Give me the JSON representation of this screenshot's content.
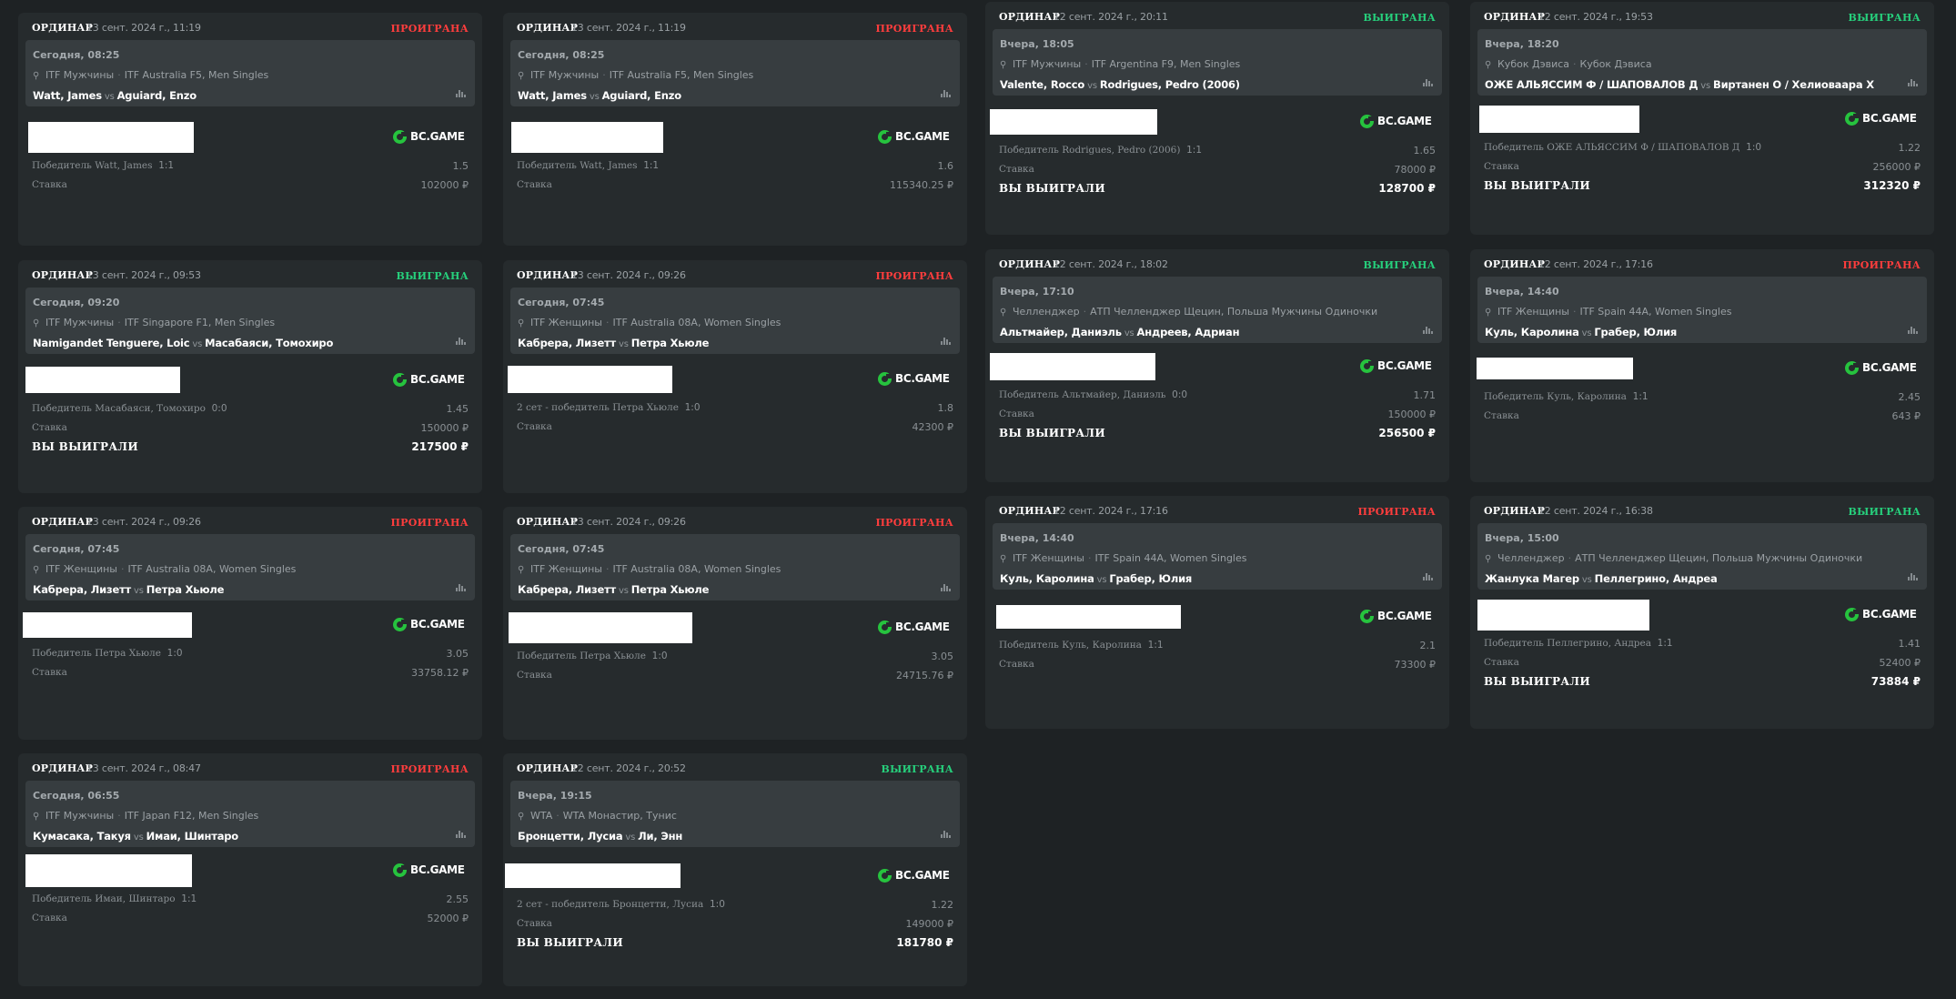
{
  "labels": {
    "type": "ОРДИНАР",
    "stake": "Ставка",
    "win": "ВЫ ВЫИГРАЛИ",
    "vs": "vs",
    "brand": "BC.GAME"
  },
  "colors": {
    "lost": "#ff3d3d",
    "won": "#26d07c",
    "brand": "#26c33e"
  },
  "icons": {
    "sport": "tennis-racket-icon",
    "stats": "stats-bars-icon",
    "brand": "bcgame-logo-icon"
  },
  "cards": [
    {
      "date": "13 сент. 2024 г., 11:19",
      "status": "ПРОИГРАНА",
      "result": "lost",
      "event_time": "Сегодня, 08:25",
      "category": "ITF Мужчины",
      "tournament": "ITF Australia F5, Men Singles",
      "team1": "Watt, James",
      "team2": "Aguiard, Enzo",
      "selection": "Победитель Watt, James",
      "score": "1:1",
      "odds": "1.5",
      "stake": "102000 ₽",
      "win_amount": ""
    },
    {
      "date": "13 сент. 2024 г., 11:19",
      "status": "ПРОИГРАНА",
      "result": "lost",
      "event_time": "Сегодня, 08:25",
      "category": "ITF Мужчины",
      "tournament": "ITF Australia F5, Men Singles",
      "team1": "Watt, James",
      "team2": "Aguiard, Enzo",
      "selection": "Победитель Watt, James",
      "score": "1:1",
      "odds": "1.6",
      "stake": "115340.25 ₽",
      "win_amount": ""
    },
    {
      "date": "12 сент. 2024 г., 20:11",
      "status": "ВЫИГРАНА",
      "result": "won",
      "event_time": "Вчера, 18:05",
      "category": "ITF Мужчины",
      "tournament": "ITF Argentina F9, Men Singles",
      "team1": "Valente, Rocco",
      "team2": "Rodrigues, Pedro (2006)",
      "selection": "Победитель Rodrigues, Pedro (2006)",
      "score": "1:1",
      "odds": "1.65",
      "stake": "78000 ₽",
      "win_amount": "128700 ₽"
    },
    {
      "date": "12 сент. 2024 г., 19:53",
      "status": "ВЫИГРАНА",
      "result": "won",
      "event_time": "Вчера, 18:20",
      "category": "Кубок Дэвиса",
      "tournament": "Кубок Дэвиса",
      "team1": "ОЖЕ АЛЬЯССИМ Ф / ШАПОВАЛОВ Д",
      "team2": "Виртанен О / Хелиоваара Х",
      "selection": "Победитель ОЖЕ АЛЬЯССИМ Ф / ШАПОВАЛОВ Д",
      "score": "1:0",
      "odds": "1.22",
      "stake": "256000 ₽",
      "win_amount": "312320 ₽"
    },
    {
      "date": "13 сент. 2024 г., 09:53",
      "status": "ВЫИГРАНА",
      "result": "won",
      "event_time": "Сегодня, 09:20",
      "category": "ITF Мужчины",
      "tournament": "ITF Singapore F1, Men Singles",
      "team1": "Namigandet Tenguere, Loic",
      "team2": "Масабаяси, Томохиро",
      "selection": "Победитель Масабаяси, Томохиро",
      "score": "0:0",
      "odds": "1.45",
      "stake": "150000 ₽",
      "win_amount": "217500 ₽"
    },
    {
      "date": "13 сент. 2024 г., 09:26",
      "status": "ПРОИГРАНА",
      "result": "lost",
      "event_time": "Сегодня, 07:45",
      "category": "ITF Женщины",
      "tournament": "ITF Australia 08A, Women Singles",
      "team1": "Кабрера, Лизетт",
      "team2": "Петра Хьюле",
      "selection": "2 сет - победитель Петра Хьюле",
      "score": "1:0",
      "odds": "1.8",
      "stake": "42300 ₽",
      "win_amount": ""
    },
    {
      "date": "12 сент. 2024 г., 18:02",
      "status": "ВЫИГРАНА",
      "result": "won",
      "event_time": "Вчера, 17:10",
      "category": "Челленджер",
      "tournament": "АТП Челленджер Щецин, Польша Мужчины Одиночки",
      "team1": "Альтмайер, Даниэль",
      "team2": "Андреев, Адриан",
      "selection": "Победитель Альтмайер, Даниэль",
      "score": "0:0",
      "odds": "1.71",
      "stake": "150000 ₽",
      "win_amount": "256500 ₽"
    },
    {
      "date": "12 сент. 2024 г., 17:16",
      "status": "ПРОИГРАНА",
      "result": "lost",
      "event_time": "Вчера, 14:40",
      "category": "ITF Женщины",
      "tournament": "ITF Spain 44A, Women Singles",
      "team1": "Куль, Каролина",
      "team2": "Грабер, Юлия",
      "selection": "Победитель Куль, Каролина",
      "score": "1:1",
      "odds": "2.45",
      "stake": "643 ₽",
      "win_amount": ""
    },
    {
      "date": "13 сент. 2024 г., 09:26",
      "status": "ПРОИГРАНА",
      "result": "lost",
      "event_time": "Сегодня, 07:45",
      "category": "ITF Женщины",
      "tournament": "ITF Australia 08A, Women Singles",
      "team1": "Кабрера, Лизетт",
      "team2": "Петра Хьюле",
      "selection": "Победитель Петра Хьюле",
      "score": "1:0",
      "odds": "3.05",
      "stake": "33758.12 ₽",
      "win_amount": ""
    },
    {
      "date": "13 сент. 2024 г., 09:26",
      "status": "ПРОИГРАНА",
      "result": "lost",
      "event_time": "Сегодня, 07:45",
      "category": "ITF Женщины",
      "tournament": "ITF Australia 08A, Women Singles",
      "team1": "Кабрера, Лизетт",
      "team2": "Петра Хьюле",
      "selection": "Победитель Петра Хьюле",
      "score": "1:0",
      "odds": "3.05",
      "stake": "24715.76 ₽",
      "win_amount": ""
    },
    {
      "date": "12 сент. 2024 г., 17:16",
      "status": "ПРОИГРАНА",
      "result": "lost",
      "event_time": "Вчера, 14:40",
      "category": "ITF Женщины",
      "tournament": "ITF Spain 44A, Women Singles",
      "team1": "Куль, Каролина",
      "team2": "Грабер, Юлия",
      "selection": "Победитель Куль, Каролина",
      "score": "1:1",
      "odds": "2.1",
      "stake": "73300 ₽",
      "win_amount": ""
    },
    {
      "date": "12 сент. 2024 г., 16:38",
      "status": "ВЫИГРАНА",
      "result": "won",
      "event_time": "Вчера, 15:00",
      "category": "Челленджер",
      "tournament": "АТП Челленджер Щецин, Польша Мужчины Одиночки",
      "team1": "Жанлука Магер",
      "team2": "Пеллегрино, Андреа",
      "selection": "Победитель Пеллегрино, Андреа",
      "score": "1:1",
      "odds": "1.41",
      "stake": "52400 ₽",
      "win_amount": "73884 ₽"
    },
    {
      "date": "13 сент. 2024 г., 08:47",
      "status": "ПРОИГРАНА",
      "result": "lost",
      "event_time": "Сегодня, 06:55",
      "category": "ITF Мужчины",
      "tournament": "ITF Japan F12, Men Singles",
      "team1": "Кумасака, Такуя",
      "team2": "Имаи, Шинтаро",
      "selection": "Победитель Имаи, Шинтаро",
      "score": "1:1",
      "odds": "2.55",
      "stake": "52000 ₽",
      "win_amount": ""
    },
    {
      "date": "12 сент. 2024 г., 20:52",
      "status": "ВЫИГРАНА",
      "result": "won",
      "event_time": "Вчера, 19:15",
      "category": "WTA",
      "tournament": "WTA Монастир, Тунис",
      "team1": "Бронцетти, Лусиа",
      "team2": "Ли, Энн",
      "selection": "2 сет - победитель Бронцетти, Лусиа",
      "score": "1:0",
      "odds": "1.22",
      "stake": "149000 ₽",
      "win_amount": "181780 ₽"
    }
  ]
}
